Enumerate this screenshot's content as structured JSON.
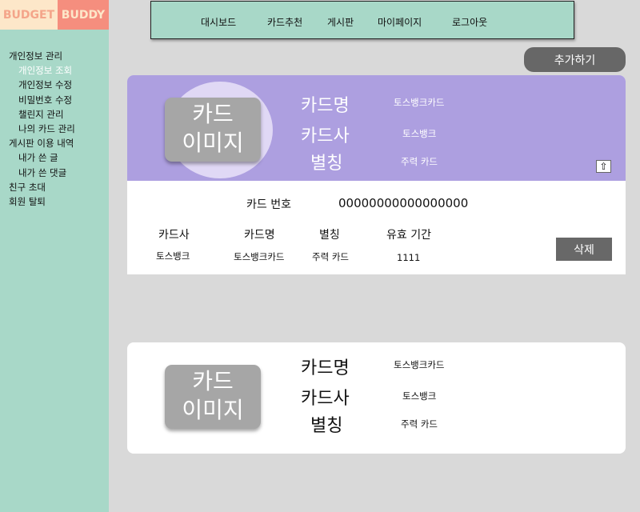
{
  "logo": {
    "left": "BUDGET",
    "right": "BUDDY"
  },
  "sidebar": {
    "items": [
      {
        "label": "개인정보 관리"
      },
      {
        "label": "개인정보 조회"
      },
      {
        "label": "개인정보 수정"
      },
      {
        "label": "비밀번호 수정"
      },
      {
        "label": "챌린지 관리"
      },
      {
        "label": "나의 카드 관리"
      },
      {
        "label": "게시판 이용 내역"
      },
      {
        "label": "내가 쓴 글"
      },
      {
        "label": "내가 쓴 댓글"
      },
      {
        "label": "친구 초대"
      },
      {
        "label": "회원 탈퇴"
      }
    ]
  },
  "nav": {
    "items": [
      {
        "label": "대시보드"
      },
      {
        "label": "카드추천"
      },
      {
        "label": "게시판"
      },
      {
        "label": "마이페이지"
      },
      {
        "label": "로그아웃"
      }
    ]
  },
  "add_button": "추가하기",
  "cards": [
    {
      "image_label_1": "카드",
      "image_label_2": "이미지",
      "name_label": "카드명",
      "name_value": "토스뱅크카드",
      "issuer_label": "카드사",
      "issuer_value": "토스뱅크",
      "alias_label": "별칭",
      "alias_value": "주력 카드",
      "collapse_icon": "⇧",
      "detail": {
        "number_label": "카드 번호",
        "number_value": "00000000000000000",
        "columns": [
          "카드사",
          "카드명",
          "별칭",
          "유효 기간"
        ],
        "values": [
          "토스뱅크",
          "토스뱅크카드",
          "주력 카드",
          "1111"
        ],
        "delete_label": "삭제"
      }
    },
    {
      "image_label_1": "카드",
      "image_label_2": "이미지",
      "name_label": "카드명",
      "name_value": "토스뱅크카드",
      "issuer_label": "카드사",
      "issuer_value": "토스뱅크",
      "alias_label": "별칭",
      "alias_value": "주력 카드"
    }
  ],
  "colors": {
    "sidebar_bg": "#a8d8c8",
    "selected_card_bg": "#ad9fe0",
    "button_gray": "#676767",
    "logo_peach": "#fde7c9",
    "logo_coral": "#f58e7e"
  }
}
